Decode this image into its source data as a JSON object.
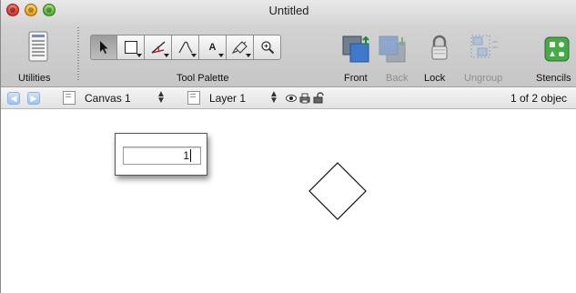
{
  "window": {
    "title": "Untitled"
  },
  "toolbar": {
    "utilities_label": "Utilities",
    "tool_palette_label": "Tool Palette",
    "tool_text_glyph": "A",
    "front_label": "Front",
    "back_label": "Back",
    "lock_label": "Lock",
    "ungroup_label": "Ungroup",
    "stencils_label": "Stencils"
  },
  "subbar": {
    "canvas_select": "Canvas 1",
    "layer_select": "Layer 1",
    "selection_status": "1 of 2 objec"
  },
  "canvas": {
    "text_field_value": "1"
  },
  "colors": {
    "disabled_text": "#8f8f8f",
    "chrome_top": "#e9e9e9",
    "chrome_bottom": "#c6c6c6"
  },
  "icons": [
    "close-button",
    "minimize-button",
    "zoom-button",
    "utilities-icon",
    "arrow-tool-icon",
    "shape-tool-icon",
    "line-tool-icon",
    "pen-tool-icon",
    "text-tool-icon",
    "style-brush-icon",
    "magnifier-icon",
    "front-icon",
    "back-icon",
    "lock-icon",
    "ungroup-icon",
    "stencils-icon",
    "nav-back-icon",
    "nav-forward-icon",
    "visible-eye-icon",
    "print-icon",
    "unlock-icon"
  ]
}
